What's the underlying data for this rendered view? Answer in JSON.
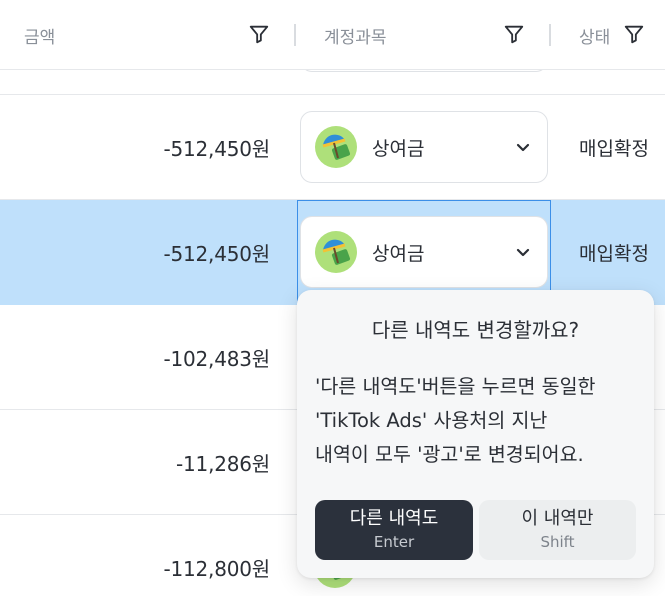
{
  "header": {
    "columns": [
      {
        "label": "금액"
      },
      {
        "label": "계정과목"
      },
      {
        "label": "상태"
      }
    ]
  },
  "rows": [
    {
      "amount": "-512,450원",
      "category": "상여금",
      "status": "매입확정",
      "selected": false
    },
    {
      "amount": "-512,450원",
      "category": "상여금",
      "status": "매입확정",
      "selected": true
    },
    {
      "amount": "-102,483원"
    },
    {
      "amount": "-11,286원"
    },
    {
      "amount": "-112,800원"
    }
  ],
  "popover": {
    "title": "다른 내역도 변경할까요?",
    "body_lines": [
      "'다른 내역도'버튼을 누르면 동일한",
      "'TikTok Ads' 사용처의 지난",
      "내역이 모두 '광고'로 변경되어요."
    ],
    "primary_button": {
      "label": "다른 내역도",
      "shortcut": "Enter"
    },
    "secondary_button": {
      "label": "이 내역만",
      "shortcut": "Shift"
    }
  },
  "colors": {
    "selected_row": "#bfe0fb",
    "selected_border": "#3b8fe8",
    "primary_button": "#2b313c",
    "icon_bg": "#aee07a"
  },
  "icons": {
    "filter": "filter-icon",
    "chevron": "chevron-down-icon",
    "category": "money-umbrella-icon"
  }
}
